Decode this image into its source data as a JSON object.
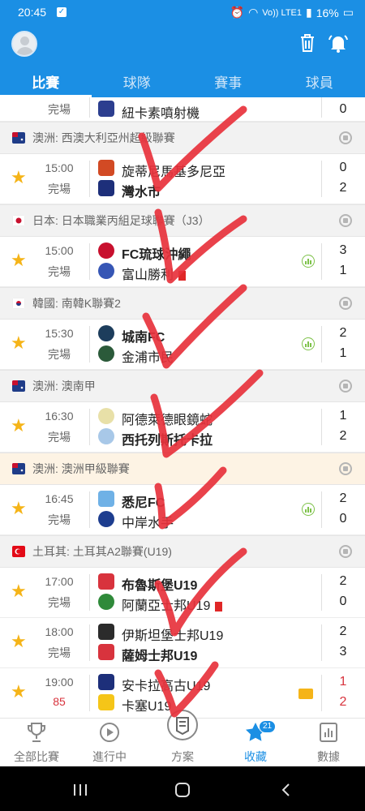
{
  "status": {
    "time": "20:45",
    "net": "Vo)) LTE1",
    "battery": "16%"
  },
  "tabs": [
    "比賽",
    "球隊",
    "賽事",
    "球員"
  ],
  "partial_top": {
    "status": "完場",
    "team": "紐卡素噴射機",
    "score": "0"
  },
  "leagues": [
    {
      "name": "澳洲: 西澳大利亞州超級聯賽",
      "flag": "australia",
      "matches": [
        {
          "time": "15:00",
          "status": "完場",
          "home": "旋蒂尼馬基多尼亞",
          "away": "灣水市",
          "home_score": "0",
          "away_score": "2",
          "winner": "away"
        }
      ]
    },
    {
      "name": "日本: 日本職業丙組足球聯賽（J3）",
      "flag": "japan",
      "matches": [
        {
          "time": "15:00",
          "status": "完場",
          "home": "FC琉球沖繩",
          "away": "富山勝利",
          "home_score": "3",
          "away_score": "1",
          "winner": "home",
          "away_card": "red"
        }
      ]
    },
    {
      "name": "韓國: 南韓K聯賽2",
      "flag": "korea",
      "matches": [
        {
          "time": "15:30",
          "status": "完場",
          "home": "城南FC",
          "away": "金浦市民",
          "home_score": "2",
          "away_score": "1",
          "winner": "home"
        }
      ]
    },
    {
      "name": "澳洲: 澳南甲",
      "flag": "australia",
      "matches": [
        {
          "time": "16:30",
          "status": "完場",
          "home": "阿德萊德眼鏡蛇",
          "away": "西托列斯托卡拉",
          "home_score": "1",
          "away_score": "2",
          "winner": "away"
        }
      ]
    },
    {
      "name": "澳洲: 澳洲甲級聯賽",
      "flag": "australia",
      "highlight": true,
      "matches": [
        {
          "time": "16:45",
          "status": "完場",
          "home": "悉尼FC",
          "away": "中岸水手",
          "home_score": "2",
          "away_score": "0",
          "winner": "home"
        }
      ]
    },
    {
      "name": "土耳其: 土耳其A2聯賽(U19)",
      "flag": "turkey",
      "matches": [
        {
          "time": "17:00",
          "status": "完場",
          "home": "布魯斯堡U19",
          "away": "阿蘭亞士邦U19",
          "home_score": "2",
          "away_score": "0",
          "winner": "home",
          "away_card": "red"
        },
        {
          "time": "18:00",
          "status": "完場",
          "home": "伊斯坦堡士邦U19",
          "away": "薩姆士邦U19",
          "home_score": "2",
          "away_score": "3",
          "winner": "away"
        },
        {
          "time": "19:00",
          "status": "85",
          "home": "安卡拉高古U19",
          "away": "卡塞U19",
          "home_score": "1",
          "away_score": "2",
          "live": true
        }
      ]
    }
  ],
  "bottom_nav": [
    {
      "label": "全部比賽",
      "icon": "trophy-icon"
    },
    {
      "label": "進行中",
      "icon": "play-icon"
    },
    {
      "label": "方案",
      "icon": "document-icon"
    },
    {
      "label": "收藏",
      "icon": "star-icon",
      "badge": "21",
      "active": true
    },
    {
      "label": "數據",
      "icon": "chart-icon"
    }
  ],
  "colors": {
    "primary": "#1b8fe4",
    "star": "#f5b418",
    "live": "#d8333d",
    "annotation": "#e8323c"
  }
}
